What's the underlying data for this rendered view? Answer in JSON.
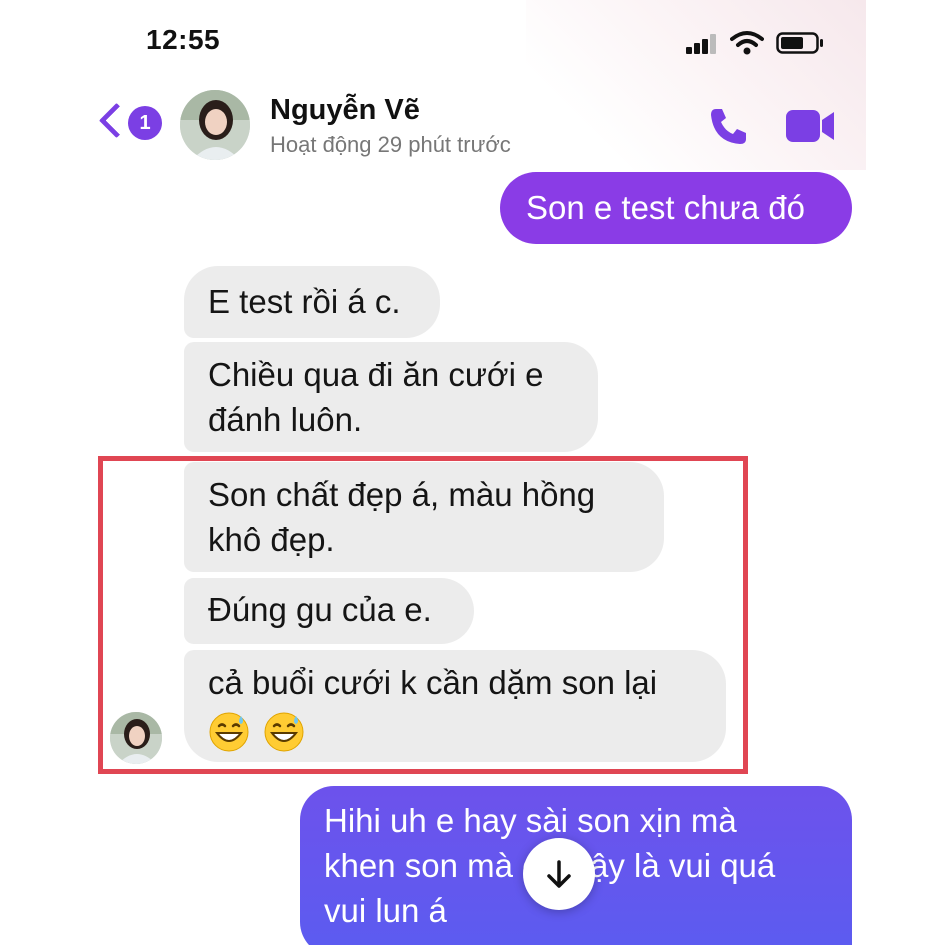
{
  "status_bar": {
    "time": "12:55"
  },
  "header": {
    "back_badge": "1",
    "contact_name": "Nguyễn Vẽ",
    "contact_status": "Hoạt động 29 phút trước"
  },
  "messages": [
    {
      "from": "me",
      "text": "Son e test chưa đó"
    },
    {
      "from": "them",
      "text": "E test rồi á c."
    },
    {
      "from": "them",
      "lines": [
        "Chiều qua đi ăn cưới e",
        "đánh luôn."
      ]
    },
    {
      "from": "them",
      "lines": [
        "Son chất đẹp á, màu hồng",
        "khô đẹp."
      ]
    },
    {
      "from": "them",
      "text": "Đúng gu của e."
    },
    {
      "from": "them",
      "lines": [
        "cả buổi cưới k cần dặm son lại",
        ""
      ],
      "emoji": [
        "grinning-sweat",
        "grinning-sweat"
      ]
    },
    {
      "from": "me",
      "lines": [
        "Hihi uh e hay sài son xịn mà",
        "khen son mà chi vậy là vui quá",
        "vui lun á"
      ]
    }
  ],
  "colors": {
    "accent": "#7b3fe4",
    "outgoing_bubble": "#8a3ce6",
    "outgoing_bubble_gradient_end": "#6d52ec",
    "incoming_bubble": "#ececec",
    "highlight_border": "#e04653"
  },
  "icons": {
    "back": "chevron-left-icon",
    "call": "phone-icon",
    "video": "video-camera-icon",
    "scroll": "arrow-down-icon"
  }
}
